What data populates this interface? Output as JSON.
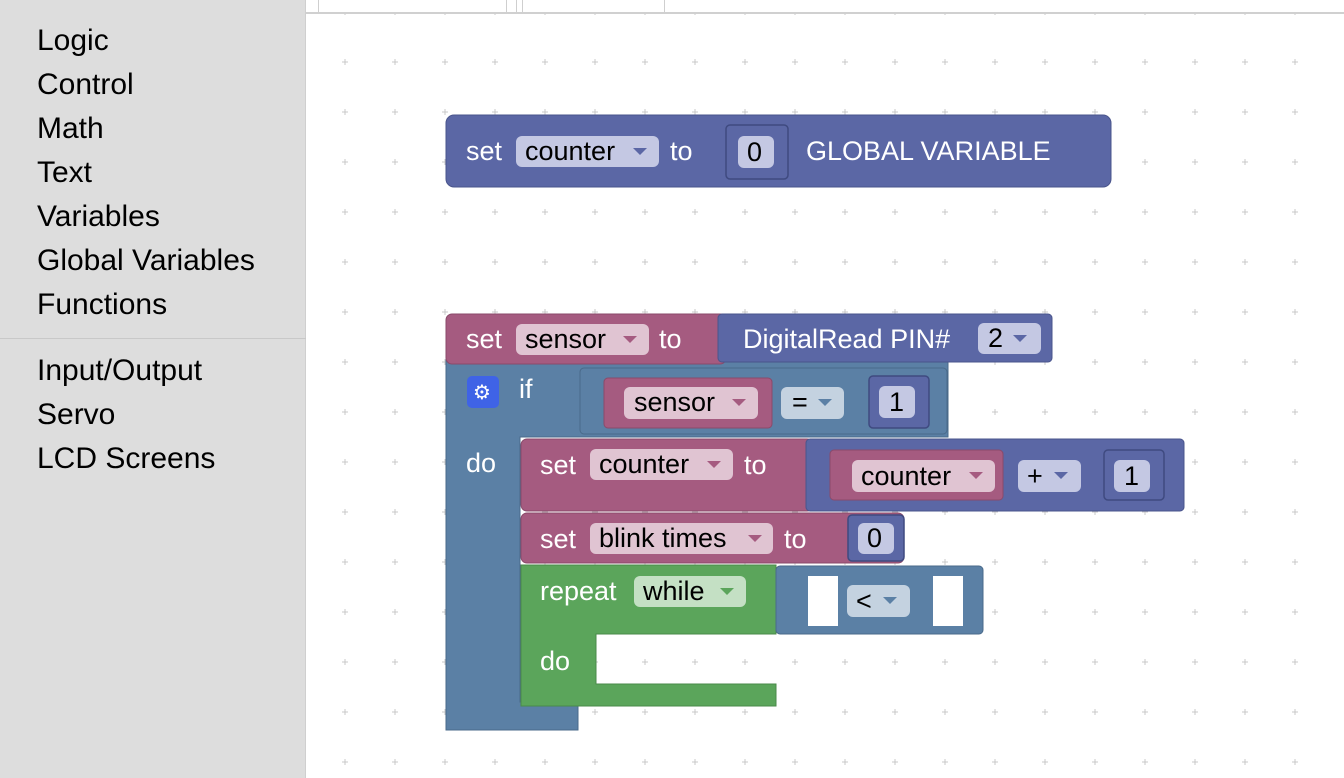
{
  "toolbox": {
    "categories": [
      "Logic",
      "Control",
      "Math",
      "Text",
      "Variables",
      "Global Variables",
      "Functions"
    ],
    "categories2": [
      "Input/Output",
      "Servo",
      "LCD Screens"
    ]
  },
  "blocks": {
    "global_set": {
      "set": "set",
      "var": "counter",
      "to": "to",
      "value": "0",
      "label": "GLOBAL VARIABLE"
    },
    "sensor_set": {
      "set": "set",
      "var": "sensor",
      "to": "to",
      "digital_read": "DigitalRead PIN#",
      "pin": "2"
    },
    "if_block": {
      "if": "if",
      "do": "do",
      "compare_var": "sensor",
      "compare_op": "=",
      "compare_value": "1"
    },
    "counter_set": {
      "set": "set",
      "var": "counter",
      "to": "to",
      "arith_var": "counter",
      "arith_op": "+",
      "arith_value": "1"
    },
    "blink_set": {
      "set": "set",
      "var": "blink times",
      "to": "to",
      "value": "0"
    },
    "repeat_block": {
      "repeat": "repeat",
      "mode": "while",
      "compare_op": "<",
      "do": "do"
    }
  },
  "colors": {
    "toolbox_bg": "#dddddd",
    "global_variable": "#5b67a5",
    "variable_set": "#a55b80",
    "logic": "#5b80a5",
    "math": "#5b67a5",
    "loop": "#5ba55b",
    "io": "#5b67a5"
  },
  "icons": {
    "if_mutator": "gear-icon",
    "dropdown": "chevron-down-icon"
  }
}
